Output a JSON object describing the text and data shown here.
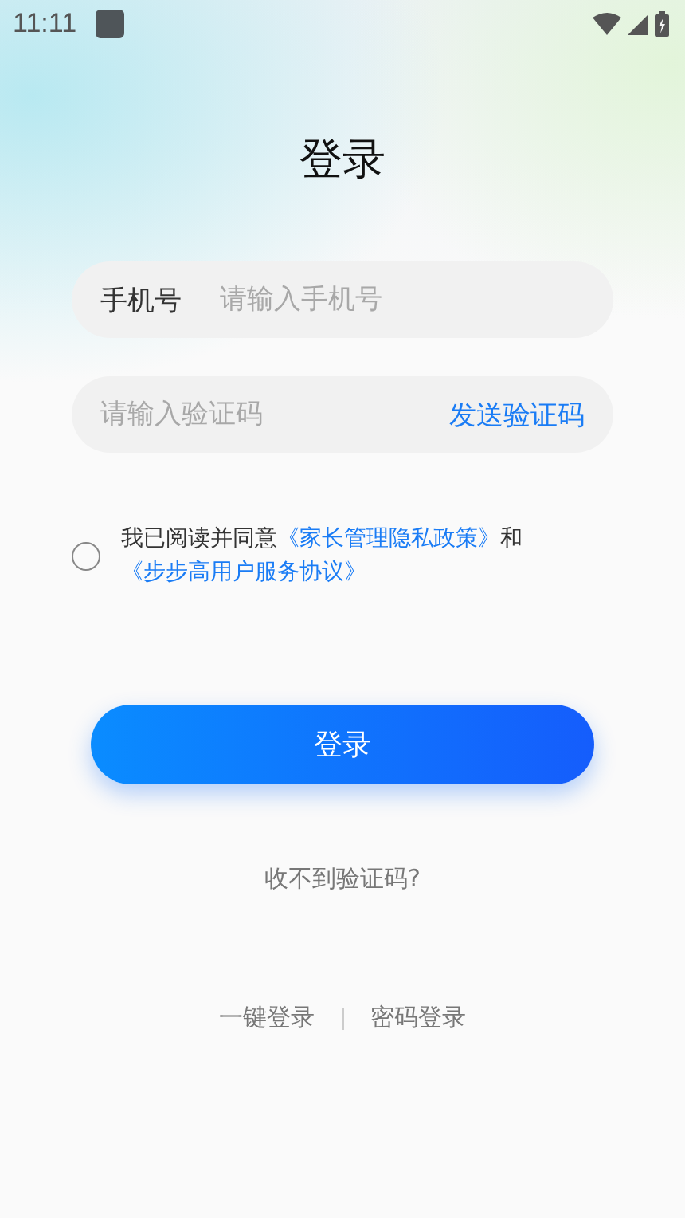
{
  "status_bar": {
    "time": "11:11"
  },
  "title": "登录",
  "phone_field": {
    "label": "手机号",
    "placeholder": "请输入手机号"
  },
  "code_field": {
    "placeholder": "请输入验证码",
    "send_button": "发送验证码"
  },
  "agreement": {
    "checked": false,
    "parts": [
      {
        "kind": "text",
        "text": "我已阅读并同意"
      },
      {
        "kind": "link",
        "text": "《家长管理隐私政策》"
      },
      {
        "kind": "text",
        "text": "和"
      },
      {
        "kind": "link",
        "text": "《步步高用户服务协议》"
      }
    ]
  },
  "login_button": "登录",
  "help_link": "收不到验证码?",
  "alt_logins": [
    "一键登录",
    "密码登录"
  ]
}
